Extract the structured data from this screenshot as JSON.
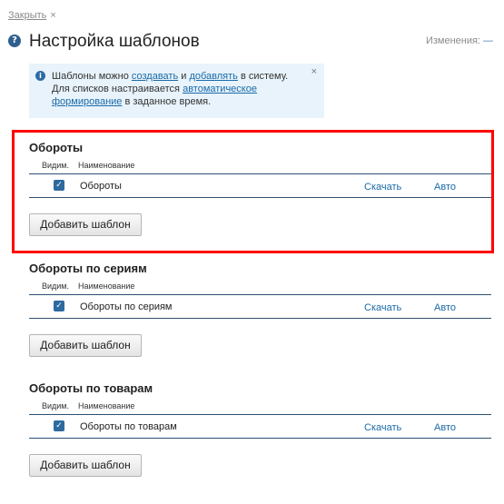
{
  "top": {
    "close_label": "Закрыть",
    "close_icon": "×"
  },
  "header": {
    "help_icon": "?",
    "title": "Настройка шаблонов",
    "changes_label": "Изменения:",
    "changes_value": "—"
  },
  "info": {
    "icon": "i",
    "text_1": "Шаблоны можно ",
    "link_create": "создавать",
    "text_2": " и ",
    "link_add": "добавлять",
    "text_3": " в систему.",
    "text_4": "Для списков настраивается ",
    "link_auto": "автоматическое формирование",
    "text_5": " в заданное время.",
    "close": "×"
  },
  "sections": [
    {
      "title": "Обороты",
      "col_visible": "Видим.",
      "col_name": "Наименование",
      "row": {
        "checked": true,
        "check": "✓",
        "name": "Обороты",
        "download": "Скачать",
        "auto": "Авто"
      },
      "add_button": "Добавить шаблон"
    },
    {
      "title": "Обороты по сериям",
      "col_visible": "Видим.",
      "col_name": "Наименование",
      "row": {
        "checked": true,
        "check": "✓",
        "name": "Обороты по сериям",
        "download": "Скачать",
        "auto": "Авто"
      },
      "add_button": "Добавить шаблон"
    },
    {
      "title": "Обороты по товарам",
      "col_visible": "Видим.",
      "col_name": "Наименование",
      "row": {
        "checked": true,
        "check": "✓",
        "name": "Обороты по товарам",
        "download": "Скачать",
        "auto": "Авто"
      },
      "add_button": "Добавить шаблон"
    }
  ],
  "colors": {
    "highlight": "#ff0000",
    "link": "#1a6aa8",
    "info_bg": "#e8f3fb"
  }
}
